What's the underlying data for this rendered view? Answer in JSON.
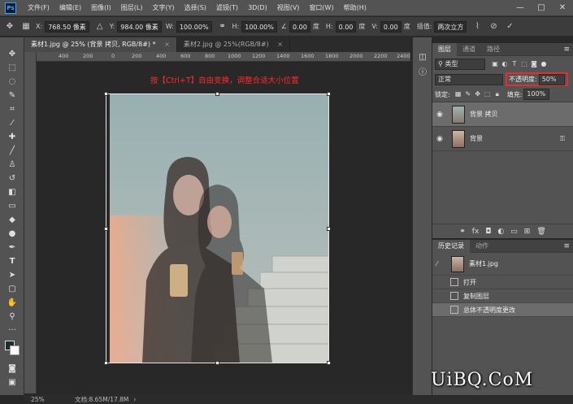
{
  "menubar": {
    "logo": "Ps",
    "items": [
      "文件(F)",
      "编辑(E)",
      "图像(I)",
      "图层(L)",
      "文字(Y)",
      "选择(S)",
      "滤镜(T)",
      "3D(D)",
      "视图(V)",
      "窗口(W)",
      "帮助(H)"
    ],
    "win_min": "—",
    "win_max": "□",
    "win_close": "✕"
  },
  "options": {
    "x_label": "X:",
    "x_value": "768.50 像素",
    "y_label": "Y:",
    "y_value": "984.00 像素",
    "w_label": "W:",
    "w_value": "100.00%",
    "h_label": "H:",
    "h_value": "100.00%",
    "angle_value": "0.00",
    "angle_unit": "度",
    "hskew_label": "H:",
    "hskew_value": "0.00",
    "hskew_unit": "度",
    "vskew_label": "V:",
    "vskew_value": "0.00",
    "vskew_unit": "度",
    "interp_label": "插值:",
    "interp_value": "两次立方"
  },
  "tabs": [
    {
      "label": "素材1.jpg @ 25% (背景 拷贝, RGB/8#) *",
      "close": "×"
    },
    {
      "label": "素材2.jpg @ 25%(RGB/8#)",
      "close": "×"
    }
  ],
  "rulers": {
    "top": [
      "400",
      "200",
      "0",
      "200",
      "400",
      "600",
      "800",
      "1000",
      "1200",
      "1400",
      "1600",
      "1800",
      "2000",
      "2200",
      "2400"
    ]
  },
  "canvas": {
    "instruction": "按【Ctrl+T】自由变换，调整合适大小位置"
  },
  "layers": {
    "tabs": [
      "图层",
      "通道",
      "路径"
    ],
    "filter_kind": "类型",
    "blend_mode": "正常",
    "opacity_label": "不透明度:",
    "opacity_value": "50%",
    "lock_label": "锁定:",
    "fill_label": "填充:",
    "fill_value": "100%",
    "items": [
      {
        "name": "背景 拷贝",
        "selected": true
      },
      {
        "name": "背景",
        "selected": false,
        "locked": true
      }
    ]
  },
  "history": {
    "tabs": [
      "历史记录",
      "动作"
    ],
    "snapshot": "素材1.jpg",
    "items": [
      {
        "name": "打开",
        "selected": false
      },
      {
        "name": "复制图层",
        "selected": false
      },
      {
        "name": "总体不透明度更改",
        "selected": true
      }
    ]
  },
  "status": {
    "zoom": "25%",
    "doc": "文档:8.65M/17.8M"
  },
  "watermark": "UiBQ.CoM",
  "colors": {
    "accent_red": "#ff2b2b",
    "highlight_box": "#e03030",
    "panel_bg": "#535353"
  }
}
